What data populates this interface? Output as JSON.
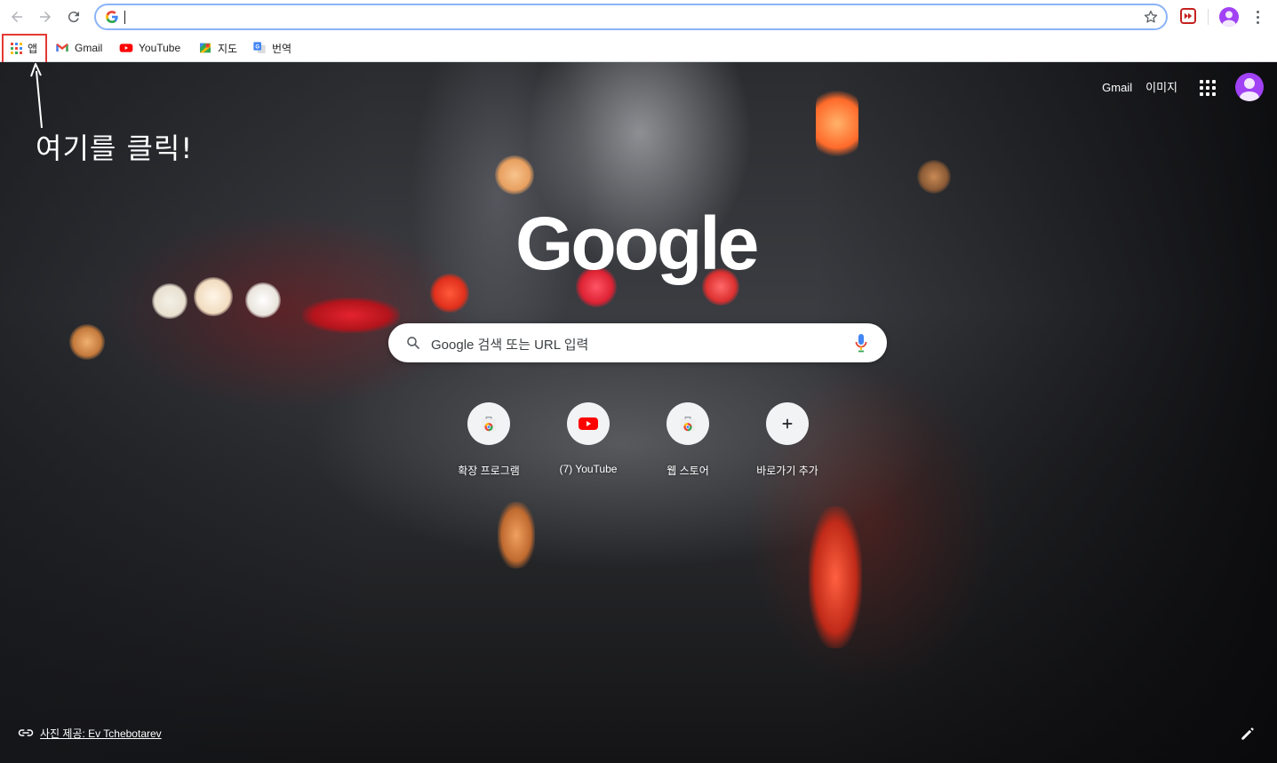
{
  "omnibox": {
    "value": ""
  },
  "bookmarks": [
    {
      "label": "앱",
      "icon": "apps-grid-icon"
    },
    {
      "label": "Gmail",
      "icon": "gmail-icon"
    },
    {
      "label": "YouTube",
      "icon": "youtube-icon"
    },
    {
      "label": "지도",
      "icon": "maps-icon"
    },
    {
      "label": "번역",
      "icon": "translate-icon"
    }
  ],
  "ntp": {
    "links": {
      "gmail": "Gmail",
      "images": "이미지"
    },
    "annotation": "여기를 클릭!",
    "logo": "Google",
    "search_placeholder": "Google 검색 또는 URL 입력",
    "shortcuts": [
      {
        "label": "확장 프로그램",
        "icon": "chrome-webstore-icon"
      },
      {
        "label": "(7) YouTube",
        "icon": "youtube-icon"
      },
      {
        "label": "웹 스토어",
        "icon": "chrome-webstore-icon"
      },
      {
        "label": "바로가기 추가",
        "icon": "plus-icon"
      }
    ],
    "credit": "사진 제공: Ev Tchebotarev"
  },
  "colors": {
    "accent_focus": "#8ab4f8",
    "highlight": "#e53935",
    "avatar": "#a142f4",
    "youtube_red": "#ff0000"
  }
}
